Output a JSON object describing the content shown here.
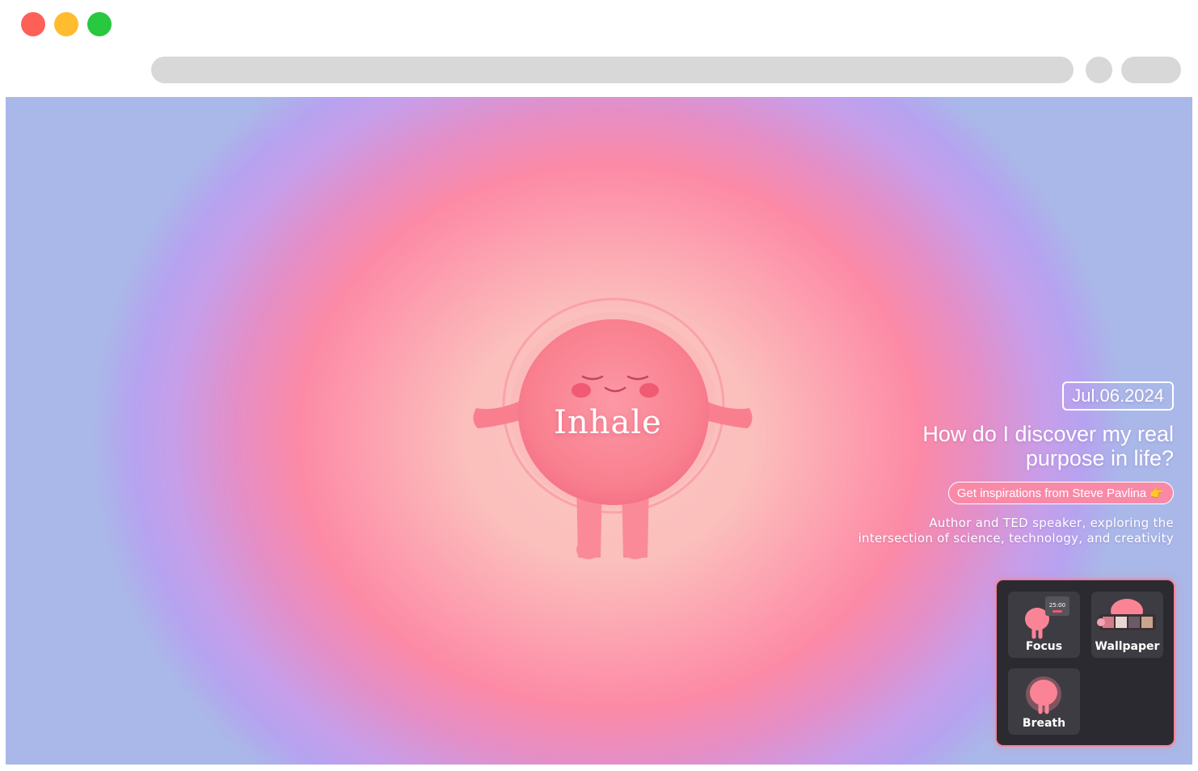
{
  "browser": {
    "window_controls": [
      "close",
      "minimize",
      "maximize"
    ]
  },
  "breath": {
    "label": "Inhale"
  },
  "info": {
    "date": "Jul.06.2024",
    "question_line1": "How do I discover my real",
    "question_line2": "purpose in life?",
    "inspiration_button": "Get inspirations from Steve Pavlina 👉",
    "description_line1": "Author and TED speaker, exploring the",
    "description_line2": "intersection of science, technology, and creativity"
  },
  "apps": [
    {
      "label": "Focus",
      "icon": "focus-timer-icon",
      "timer_text": "25:00"
    },
    {
      "label": "Wallpaper",
      "icon": "wallpaper-icon"
    },
    {
      "label": "Breath",
      "icon": "breath-blob-icon"
    }
  ],
  "colors": {
    "accent_pink": "#f98aa7",
    "panel_bg": "#2b2a30",
    "tile_bg": "#3d3c42"
  }
}
